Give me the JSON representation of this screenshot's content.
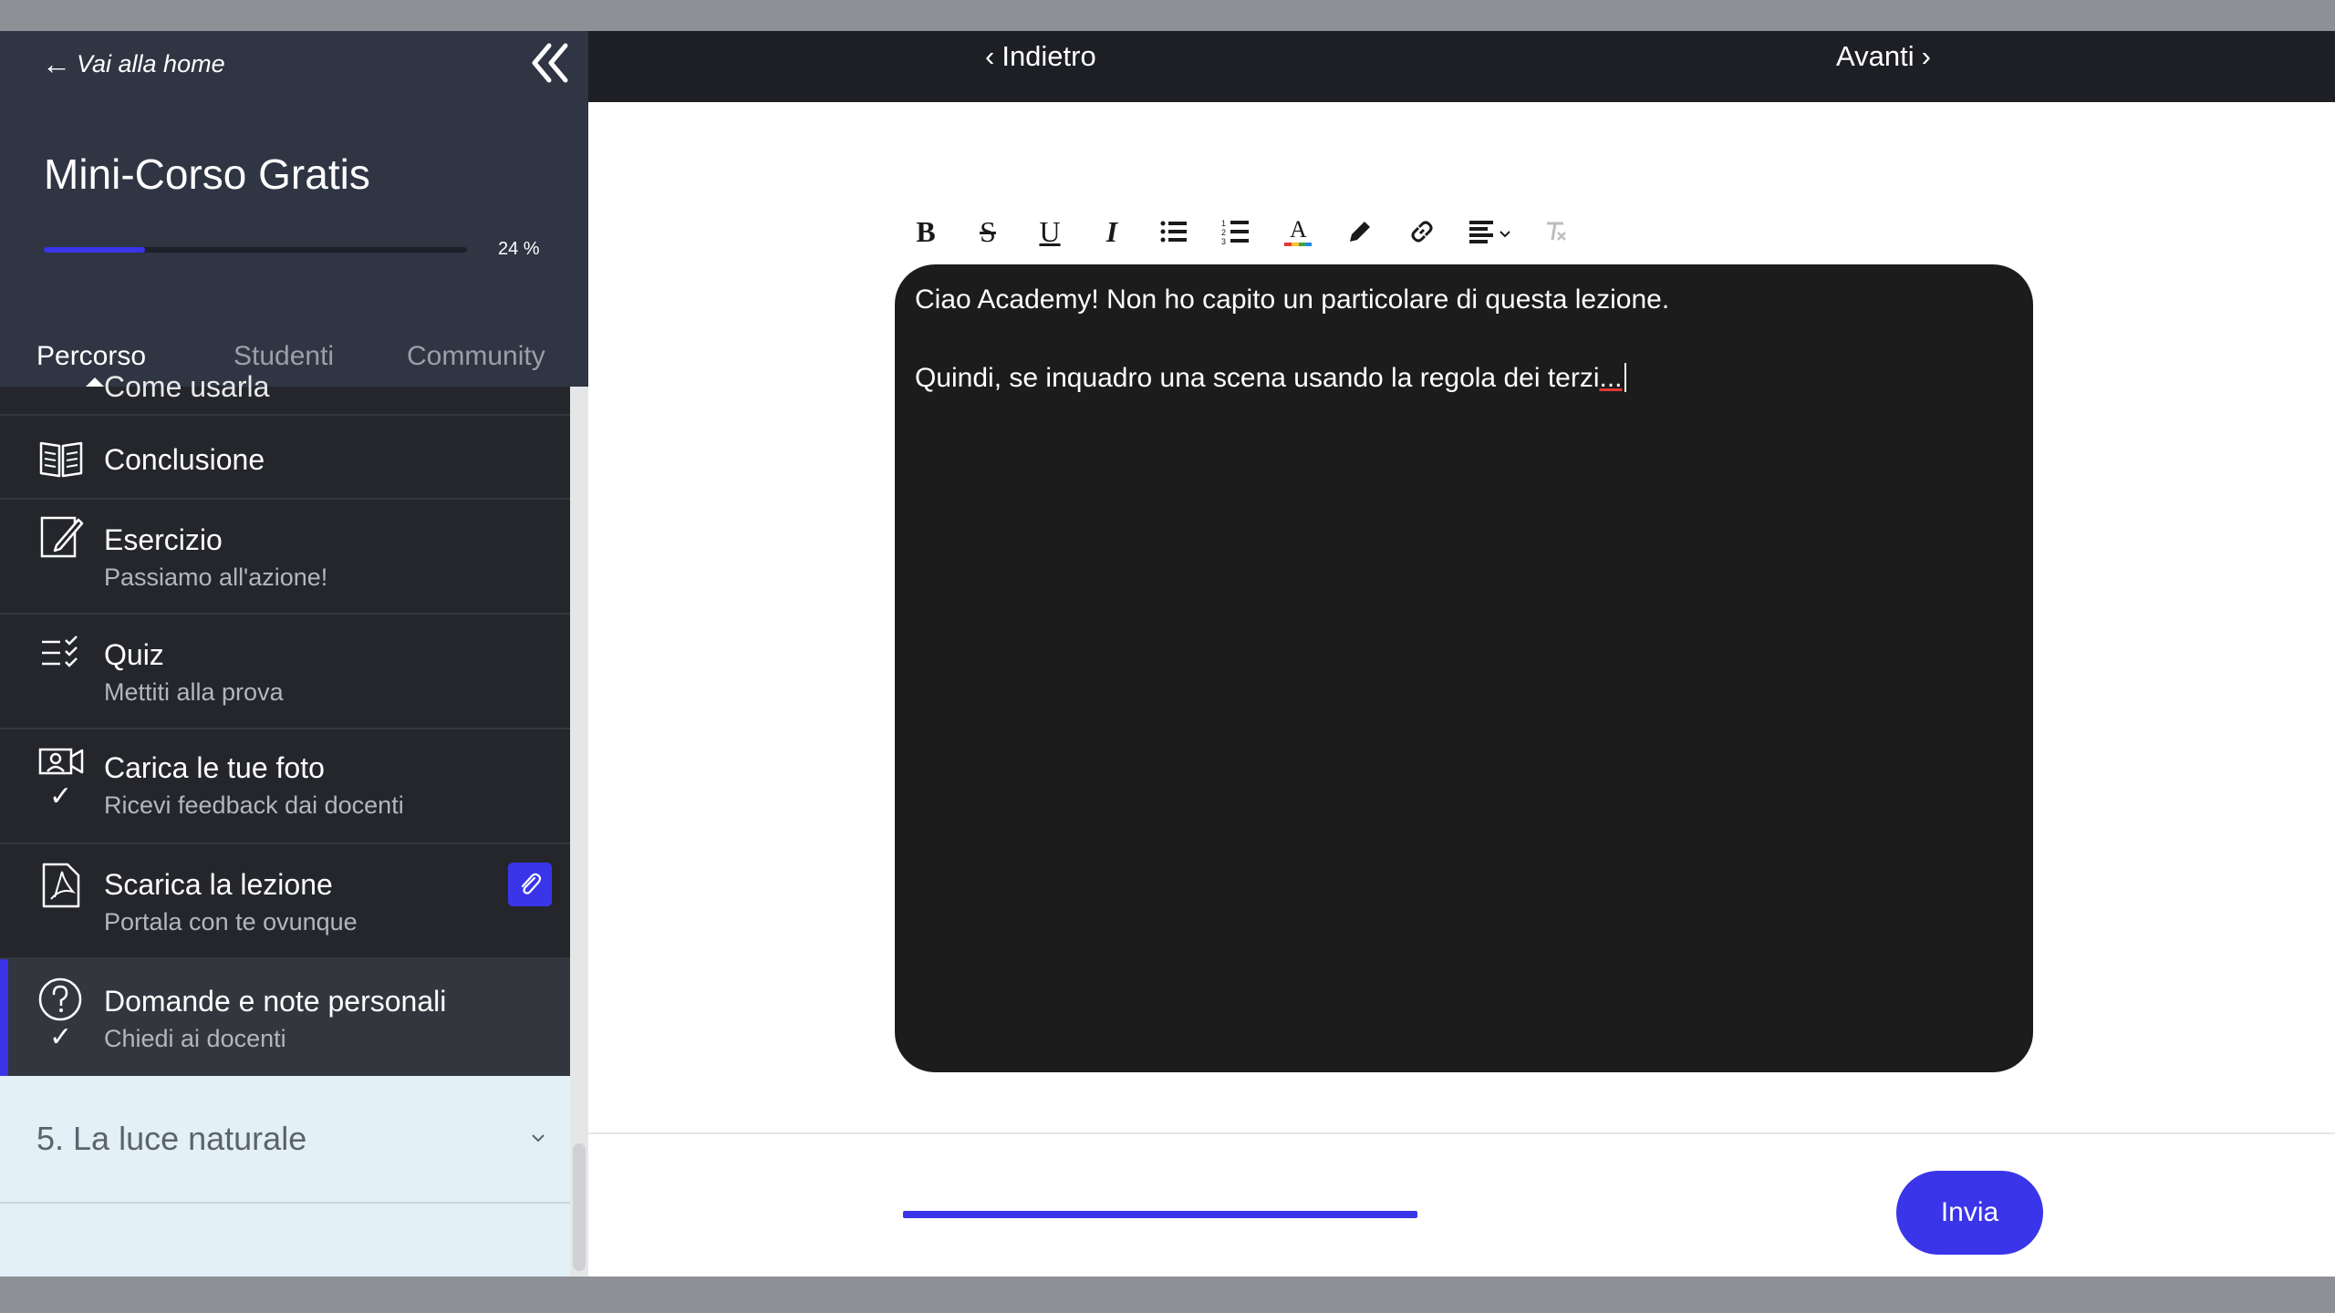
{
  "sidebar": {
    "home_link": "Vai alla home",
    "course_title": "Mini-Corso Gratis",
    "progress": {
      "percent": 24,
      "label": "24 %"
    },
    "tabs": [
      {
        "label": "Percorso",
        "active": true
      },
      {
        "label": "Studenti",
        "active": false
      },
      {
        "label": "Community",
        "active": false
      }
    ],
    "cut_item_label": "Come usarla",
    "lessons": [
      {
        "title": "Conclusione",
        "subtitle": "",
        "icon": "book-open-icon",
        "completed": false,
        "active": false
      },
      {
        "title": "Esercizio",
        "subtitle": "Passiamo all'azione!",
        "icon": "edit-note-icon",
        "completed": false,
        "active": false
      },
      {
        "title": "Quiz",
        "subtitle": "Mettiti alla prova",
        "icon": "checklist-icon",
        "completed": false,
        "active": false
      },
      {
        "title": "Carica le tue foto",
        "subtitle": "Ricevi feedback dai docenti",
        "icon": "video-upload-icon",
        "completed": true,
        "active": false
      },
      {
        "title": "Scarica la lezione",
        "subtitle": "Portala con te ovunque",
        "icon": "pdf-icon",
        "completed": false,
        "active": false,
        "attachment": true
      },
      {
        "title": "Domande e note personali",
        "subtitle": "Chiedi ai docenti",
        "icon": "question-circle-icon",
        "completed": true,
        "active": true
      }
    ],
    "chapter": {
      "label": "5. La luce naturale"
    }
  },
  "topnav": {
    "back": "Indietro",
    "next": "Avanti"
  },
  "editor": {
    "line1": "Ciao Academy! Non ho capito un particolare di questa lezione.",
    "line2": "Quindi, se inquadro una scena usando la regola dei terzi",
    "line2_tail": "..."
  },
  "footer": {
    "send_label": "Invia"
  },
  "colors": {
    "accent": "#3a35e8",
    "sidebar_bg": "#2d3340",
    "lesson_bg": "#24262b",
    "editor_bg": "#1c1c1c"
  }
}
